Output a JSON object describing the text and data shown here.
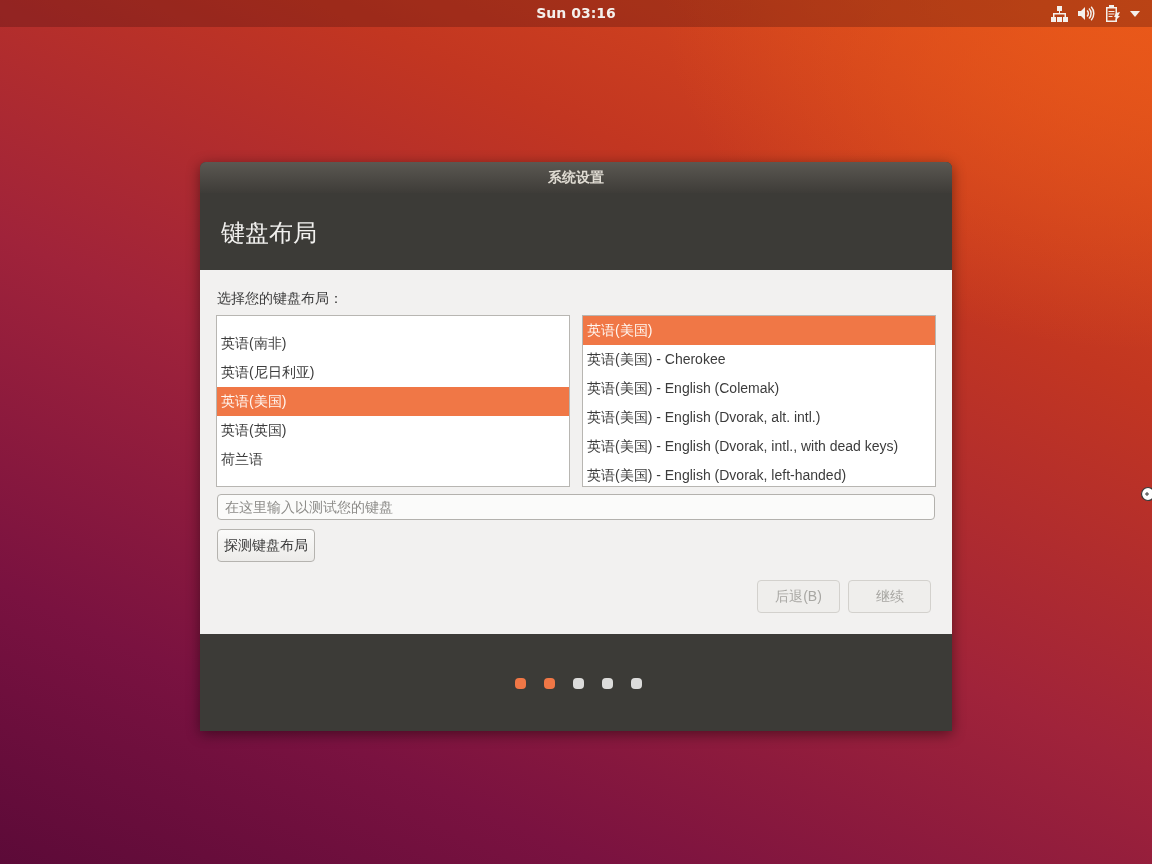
{
  "top_bar": {
    "clock": "Sun 03:16"
  },
  "window": {
    "title": "系统设置",
    "heading": "键盘布局"
  },
  "layout_label": "选择您的键盘布局：",
  "languages": [
    {
      "label": "英语(南非)",
      "selected": false
    },
    {
      "label": "英语(尼日利亚)",
      "selected": false
    },
    {
      "label": "英语(美国)",
      "selected": true
    },
    {
      "label": "英语(英国)",
      "selected": false
    },
    {
      "label": "荷兰语",
      "selected": false
    }
  ],
  "variants": [
    {
      "label": "英语(美国)",
      "selected": true
    },
    {
      "label": "英语(美国) - Cherokee",
      "selected": false
    },
    {
      "label": "英语(美国) - English (Colemak)",
      "selected": false
    },
    {
      "label": "英语(美国) - English (Dvorak, alt. intl.)",
      "selected": false
    },
    {
      "label": "英语(美国) - English (Dvorak, intl., with dead keys)",
      "selected": false
    },
    {
      "label": "英语(美国) - English (Dvorak, left-handed)",
      "selected": false
    }
  ],
  "test_field": {
    "placeholder": "在这里输入以测试您的键盘"
  },
  "detect_button": "探测键盘布局",
  "nav_buttons": [
    {
      "label": "后退(B)",
      "disabled": true
    },
    {
      "label": "继续",
      "disabled": true
    }
  ],
  "steps": [
    {
      "completed": true
    },
    {
      "completed": true
    },
    {
      "completed": false
    },
    {
      "completed": false
    },
    {
      "completed": false
    }
  ]
}
